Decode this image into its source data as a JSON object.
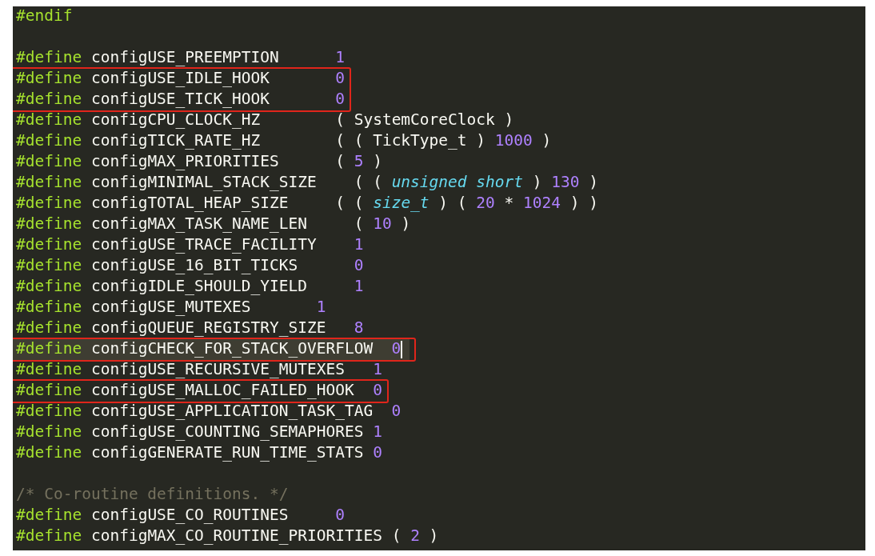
{
  "editor": {
    "lines": [
      {
        "kind": "code",
        "directive": "#endif"
      },
      {
        "kind": "blank"
      },
      {
        "kind": "code",
        "directive": "#define",
        "name": "configUSE_PREEMPTION",
        "value": [
          {
            "kind": "number",
            "text": "      1"
          }
        ]
      },
      {
        "kind": "box",
        "children": [
          {
            "kind": "code",
            "directive": "#define",
            "name": "configUSE_IDLE_HOOK",
            "value": [
              {
                "kind": "number",
                "text": "       0"
              }
            ]
          },
          {
            "kind": "code",
            "directive": "#define",
            "name": "configUSE_TICK_HOOK",
            "value": [
              {
                "kind": "number",
                "text": "       0"
              }
            ]
          }
        ]
      },
      {
        "kind": "code",
        "directive": "#define",
        "name": "configCPU_CLOCK_HZ",
        "value": [
          {
            "kind": "plain",
            "text": "        ( SystemCoreClock )"
          }
        ]
      },
      {
        "kind": "code",
        "directive": "#define",
        "name": "configTICK_RATE_HZ",
        "value": [
          {
            "kind": "plain",
            "text": "        ( ( TickType_t ) "
          },
          {
            "kind": "number",
            "text": "1000"
          },
          {
            "kind": "plain",
            "text": " )"
          }
        ]
      },
      {
        "kind": "code",
        "directive": "#define",
        "name": "configMAX_PRIORITIES",
        "value": [
          {
            "kind": "plain",
            "text": "      ( "
          },
          {
            "kind": "number",
            "text": "5"
          },
          {
            "kind": "plain",
            "text": " )"
          }
        ]
      },
      {
        "kind": "code",
        "directive": "#define",
        "name": "configMINIMAL_STACK_SIZE",
        "value": [
          {
            "kind": "plain",
            "text": "    ( ( "
          },
          {
            "kind": "type",
            "text": "unsigned short"
          },
          {
            "kind": "plain",
            "text": " ) "
          },
          {
            "kind": "number",
            "text": "130"
          },
          {
            "kind": "plain",
            "text": " )"
          }
        ]
      },
      {
        "kind": "code",
        "directive": "#define",
        "name": "configTOTAL_HEAP_SIZE",
        "value": [
          {
            "kind": "plain",
            "text": "     ( ( "
          },
          {
            "kind": "type",
            "text": "size_t"
          },
          {
            "kind": "plain",
            "text": " ) ( "
          },
          {
            "kind": "number",
            "text": "20"
          },
          {
            "kind": "plain",
            "text": " * "
          },
          {
            "kind": "number",
            "text": "1024"
          },
          {
            "kind": "plain",
            "text": " ) )"
          }
        ]
      },
      {
        "kind": "code",
        "directive": "#define",
        "name": "configMAX_TASK_NAME_LEN",
        "value": [
          {
            "kind": "plain",
            "text": "     ( "
          },
          {
            "kind": "number",
            "text": "10"
          },
          {
            "kind": "plain",
            "text": " )"
          }
        ]
      },
      {
        "kind": "code",
        "directive": "#define",
        "name": "configUSE_TRACE_FACILITY",
        "value": [
          {
            "kind": "number",
            "text": "    1"
          }
        ]
      },
      {
        "kind": "code",
        "directive": "#define",
        "name": "configUSE_16_BIT_TICKS",
        "value": [
          {
            "kind": "number",
            "text": "      0"
          }
        ]
      },
      {
        "kind": "code",
        "directive": "#define",
        "name": "configIDLE_SHOULD_YIELD",
        "value": [
          {
            "kind": "number",
            "text": "     1"
          }
        ]
      },
      {
        "kind": "code",
        "directive": "#define",
        "name": "configUSE_MUTEXES",
        "value": [
          {
            "kind": "number",
            "text": "       1"
          }
        ]
      },
      {
        "kind": "code",
        "directive": "#define",
        "name": "configQUEUE_REGISTRY_SIZE",
        "value": [
          {
            "kind": "number",
            "text": "   8"
          }
        ]
      },
      {
        "kind": "box",
        "children": [
          {
            "kind": "code",
            "directive": "#define",
            "name": "configCHECK_FOR_STACK_OVERFLOW",
            "current": true,
            "value": [
              {
                "kind": "number",
                "text": "  0"
              }
            ]
          }
        ]
      },
      {
        "kind": "code",
        "directive": "#define",
        "name": "configUSE_RECURSIVE_MUTEXES",
        "value": [
          {
            "kind": "number",
            "text": "   1"
          }
        ]
      },
      {
        "kind": "box",
        "children": [
          {
            "kind": "code",
            "directive": "#define",
            "name": "configUSE_MALLOC_FAILED_HOOK",
            "value": [
              {
                "kind": "number",
                "text": "  0"
              }
            ]
          }
        ]
      },
      {
        "kind": "code",
        "directive": "#define",
        "name": "configUSE_APPLICATION_TASK_TAG",
        "value": [
          {
            "kind": "number",
            "text": "  0"
          }
        ]
      },
      {
        "kind": "code",
        "directive": "#define",
        "name": "configUSE_COUNTING_SEMAPHORES",
        "value": [
          {
            "kind": "number",
            "text": " 1"
          }
        ]
      },
      {
        "kind": "code",
        "directive": "#define",
        "name": "configGENERATE_RUN_TIME_STATS",
        "value": [
          {
            "kind": "number",
            "text": " 0"
          }
        ]
      },
      {
        "kind": "blank"
      },
      {
        "kind": "comment",
        "text": "/* Co-routine definitions. */"
      },
      {
        "kind": "code",
        "directive": "#define",
        "name": "configUSE_CO_ROUTINES",
        "value": [
          {
            "kind": "number",
            "text": "     0"
          }
        ]
      },
      {
        "kind": "code",
        "directive": "#define",
        "name": "configMAX_CO_ROUTINE_PRIORITIES",
        "value": [
          {
            "kind": "plain",
            "text": " ( "
          },
          {
            "kind": "number",
            "text": "2"
          },
          {
            "kind": "plain",
            "text": " )"
          }
        ]
      }
    ]
  }
}
